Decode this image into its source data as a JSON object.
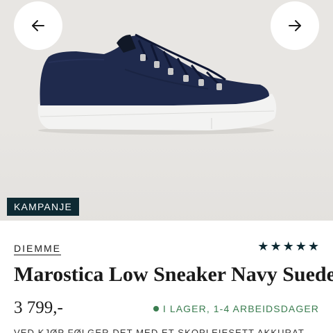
{
  "navigation": {
    "prev_icon": "arrow-left-icon",
    "next_icon": "arrow-right-icon"
  },
  "product": {
    "image_alt": "Navy suede low sneaker",
    "badge": "KAMPANJE",
    "brand": "DIEMME",
    "name": "Marostica Low Sneaker Navy Suede",
    "price": "3 799,-",
    "rating_stars": 5,
    "stock": "I LAGER, 1-4 ARBEIDSDAGER",
    "promo_text": "VED KJØP FØLGER DET MED ET SKOPLEIESETT AKKURAT"
  },
  "colors": {
    "accent_dark": "#0e2a33",
    "stock_green": "#3a7d4f",
    "shoe_navy": "#1f2a4d"
  }
}
